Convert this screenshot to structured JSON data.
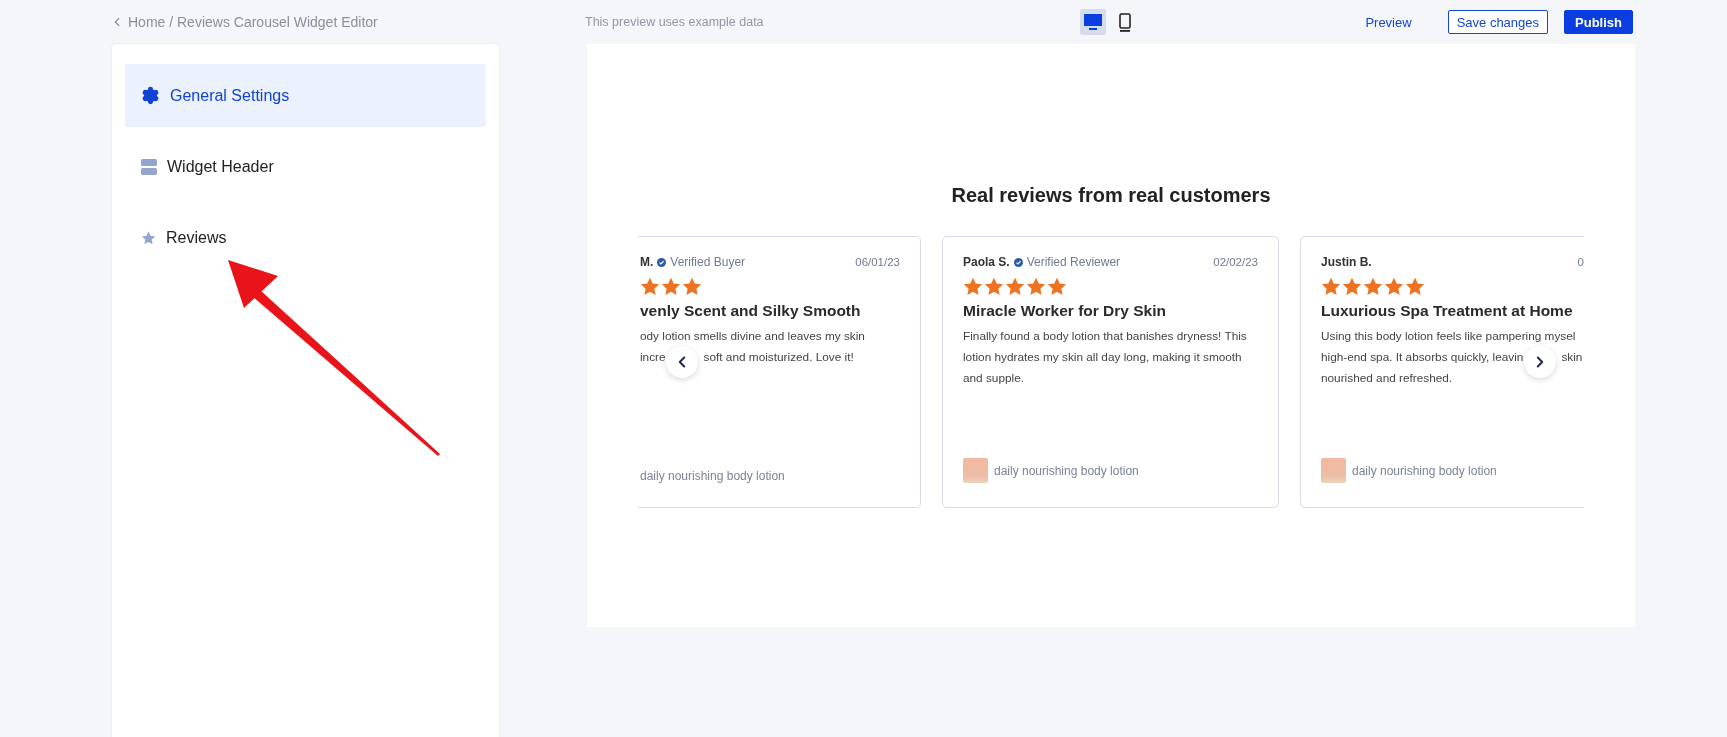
{
  "breadcrumb": "Home / Reviews Carousel Widget Editor",
  "preview_note": "This preview uses example data",
  "devices": [
    {
      "kind": "desktop",
      "selected": true
    },
    {
      "kind": "mobile",
      "selected": false
    }
  ],
  "actions": [
    {
      "kind": "link",
      "label": "Preview"
    },
    {
      "kind": "outline",
      "label": "Save changes"
    },
    {
      "kind": "primary",
      "label": "Publish"
    }
  ],
  "sidebar": {
    "items": [
      {
        "kind": "gear",
        "label": "General Settings",
        "selected": true
      },
      {
        "kind": "header",
        "label": "Widget Header",
        "selected": false
      },
      {
        "kind": "star",
        "label": "Reviews",
        "selected": false
      }
    ]
  },
  "preview": {
    "heading": "Real reviews from real customers",
    "cards": [
      {
        "kind": "clipped-left",
        "name": "M.",
        "verified": true,
        "badge": "Verified Buyer",
        "date": "06/01/23",
        "stars": 3,
        "title": "venly Scent and Silky Smooth",
        "body": [
          "ody lotion smells divine and leaves my skin",
          [
            "incre",
            "soft and moisturized. Love it!"
          ]
        ],
        "product": "daily nourishing body lotion",
        "thumbnail": false
      },
      {
        "kind": "full",
        "name": "Paola S.",
        "verified": true,
        "badge": "Verified Reviewer",
        "date": "02/02/23",
        "stars": 5,
        "title": "Miracle Worker for Dry Skin",
        "body": [
          "Finally found a body lotion that banishes dryness! This",
          "lotion hydrates my skin all day long, making it smooth",
          "and supple."
        ],
        "product": "daily nourishing body lotion",
        "thumbnail": true
      },
      {
        "kind": "clipped-right",
        "name": "Justin B.",
        "verified": false,
        "date": "0",
        "stars": 5,
        "title": "Luxurious Spa Treatment at Home",
        "body": [
          "Using this body lotion feels like pampering mysel",
          [
            "high-end spa. It absorbs quickly, leavin",
            "skin"
          ],
          "nourished and refreshed."
        ],
        "product": "daily nourishing body lotion",
        "thumbnail": true
      }
    ]
  }
}
